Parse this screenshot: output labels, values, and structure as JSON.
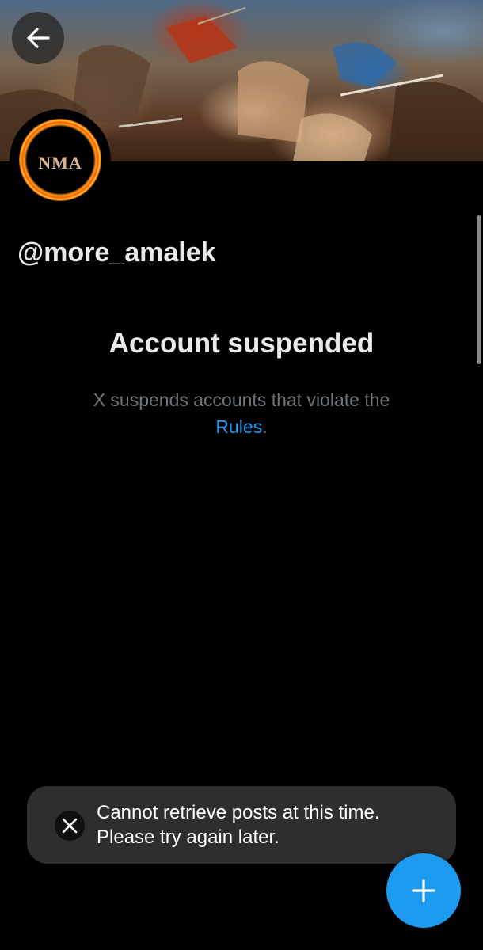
{
  "profile": {
    "handle": "@more_amalek",
    "avatar_text": "NMA"
  },
  "suspension": {
    "title": "Account suspended",
    "message": "X suspends accounts that violate the",
    "link_text": "Rules",
    "link_suffix": "."
  },
  "toast": {
    "message": "Cannot retrieve posts at this time.\nPlease try again later."
  },
  "icons": {
    "back": "arrow-left-icon",
    "toast": "x-logo-icon",
    "compose": "plus-icon"
  },
  "colors": {
    "background": "#000000",
    "accent": "#1d9bf0",
    "muted_text": "#71767b",
    "toast_bg": "#2e2e2e"
  }
}
